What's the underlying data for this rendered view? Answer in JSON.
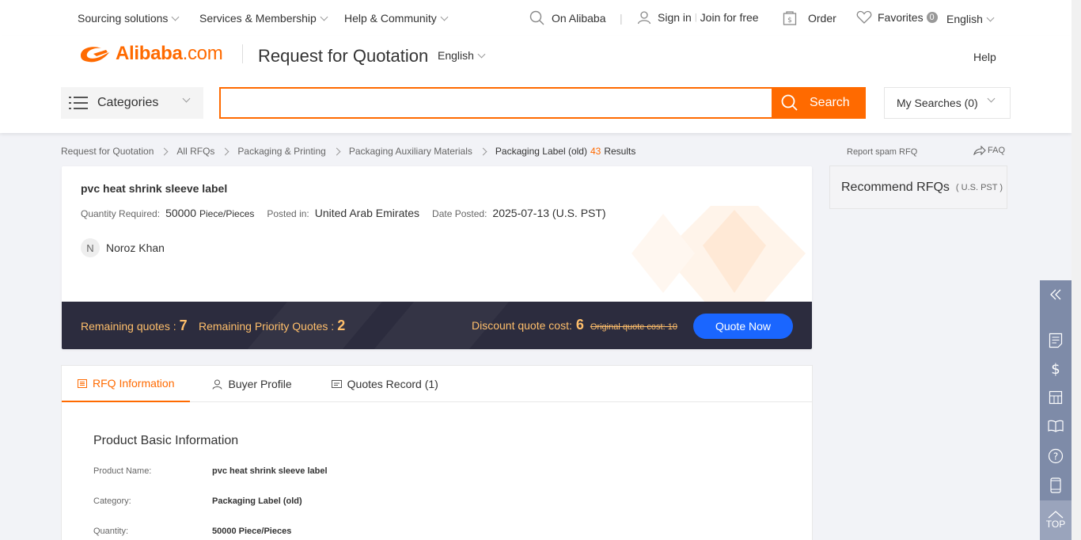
{
  "topbar": {
    "sourcing": "Sourcing solutions",
    "services": "Services & Membership",
    "help_community": "Help & Community",
    "on_alibaba": "On Alibaba",
    "sign_in": "Sign in",
    "join": "Join for free",
    "order": "Order",
    "favorites": "Favorites",
    "favorites_count": "0",
    "language": "English"
  },
  "header": {
    "logo_main": "Alibaba",
    "logo_com": ".com",
    "title": "Request for Quotation",
    "language": "English",
    "help": "Help",
    "categories": "Categories",
    "search_value": "",
    "search_button": "Search",
    "my_searches": "My Searches (0)"
  },
  "breadcrumb": {
    "items": [
      "Request for Quotation",
      "All RFQs",
      "Packaging & Printing",
      "Packaging Auxiliary Materials"
    ],
    "current": "Packaging Label (old)",
    "count": "43",
    "results_label": "Results"
  },
  "rfq": {
    "title": "pvc heat shrink sleeve label",
    "qty_label": "Quantity Required:",
    "qty_value": "50000",
    "qty_unit": "Piece/Pieces",
    "posted_label": "Posted in:",
    "posted_value": "United Arab Emirates",
    "date_label": "Date Posted:",
    "date_value": "2025-07-13 (U.S. PST)",
    "buyer_initial": "N",
    "buyer_name": "Noroz Khan",
    "remaining_quotes_label": "Remaining quotes :",
    "remaining_quotes": "7",
    "remaining_priority_label": "Remaining Priority Quotes :",
    "remaining_priority": "2",
    "discount_label": "Discount quote cost:",
    "discount_value": "6",
    "original_cost": "Original quote cost: 10",
    "quote_button": "Quote Now"
  },
  "tabs": [
    {
      "label": "RFQ Information",
      "active": true
    },
    {
      "label": "Buyer Profile",
      "active": false
    },
    {
      "label": "Quotes Record (1)",
      "active": false
    }
  ],
  "product_info": {
    "section_title": "Product Basic Information",
    "rows": [
      {
        "key": "Product Name:",
        "value": "pvc heat shrink sleeve label"
      },
      {
        "key": "Category:",
        "value": "Packaging Label (old)"
      },
      {
        "key": "Quantity:",
        "value": "50000 Piece/Pieces"
      }
    ]
  },
  "right": {
    "report_spam": "Report spam RFQ",
    "faq": "FAQ",
    "recommend": "Recommend RFQs",
    "timezone": "( U.S. PST )"
  },
  "sidebar": {
    "top_label": "TOP"
  },
  "colors": {
    "brand_orange": "#ff6a00",
    "quote_blue": "#1a66ff",
    "footer_dark": "#2c2c3e",
    "footer_text": "#ffbf6b",
    "sidebar": "#7e8ba8"
  }
}
